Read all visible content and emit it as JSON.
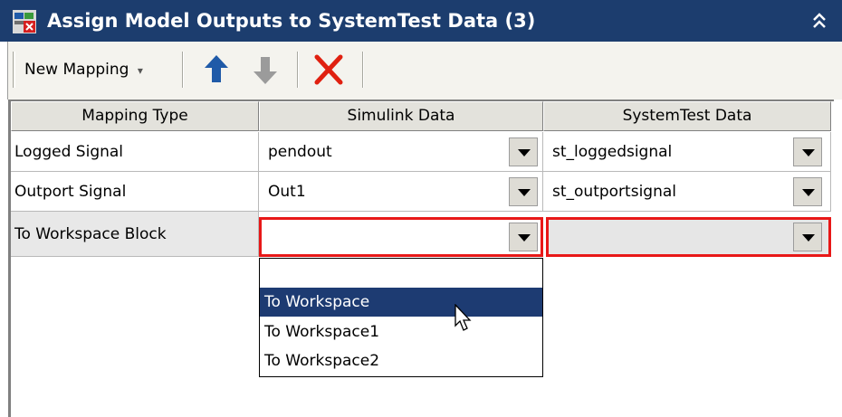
{
  "window": {
    "title": "Assign Model Outputs to SystemTest Data (3)",
    "collapse_glyph": "⌃\n⌃"
  },
  "toolbar": {
    "new_mapping_label": "New Mapping",
    "new_mapping_caret": "▾",
    "move_up_icon": "arrow-up-icon",
    "move_down_icon": "arrow-down-icon",
    "delete_icon": "red-x-icon"
  },
  "table": {
    "headers": [
      "Mapping Type",
      "Simulink Data",
      "SystemTest Data"
    ],
    "rows": [
      {
        "mapping_type": "Logged Signal",
        "simulink_data": "pendout",
        "systemtest_data": "st_loggedsignal"
      },
      {
        "mapping_type": "Outport Signal",
        "simulink_data": "Out1",
        "systemtest_data": "st_outportsignal"
      },
      {
        "mapping_type": "To Workspace Block",
        "simulink_data": "",
        "systemtest_data": ""
      }
    ]
  },
  "dropdown": {
    "options": [
      "",
      "To Workspace",
      "To Workspace1",
      "To Workspace2"
    ],
    "selected_index": 1
  },
  "colors": {
    "titlebar": "#1c3d6e",
    "selection": "#1d3b72",
    "highlight_border": "#e81818",
    "delete_icon": "#e02010",
    "arrow_up": "#1f5aa8",
    "arrow_down": "#9b9b9b"
  }
}
